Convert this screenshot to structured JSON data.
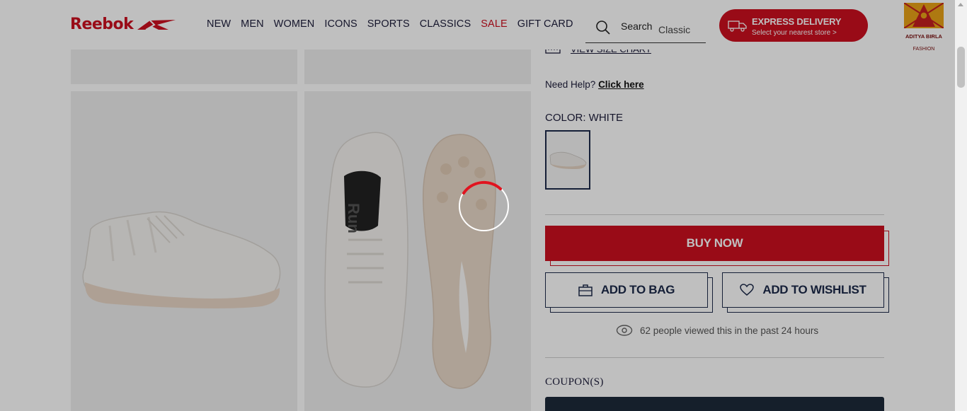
{
  "header": {
    "brand": "Reebok",
    "nav": [
      "NEW",
      "MEN",
      "WOMEN",
      "ICONS",
      "SPORTS",
      "CLASSICS",
      "SALE",
      "GIFT CARD"
    ],
    "search": {
      "label": "Search",
      "rotating_term": "Classic"
    },
    "express": {
      "title": "EXPRESS DELIVERY",
      "subtitle": "Select your nearest store >"
    },
    "partner": {
      "name": "ADITYA BIRLA",
      "sub": "FASHION"
    }
  },
  "product": {
    "size_chart_link": "VIEW SIZE CHART",
    "help_text": "Need Help?",
    "help_link": "Click here",
    "color_label": "COLOR: WHITE",
    "buy_now": "BUY NOW",
    "add_to_bag": "ADD TO BAG",
    "add_to_wishlist": "ADD TO WISHLIST",
    "viewed_text": "62 people viewed this in the past 24 hours",
    "coupons_label": "COUPON(S)"
  },
  "colors": {
    "brand_red": "#cc0f1f",
    "navy": "#1c2a4a",
    "overlay": "rgba(0,0,0,0.25)"
  },
  "icons": [
    "reebok-vector-logo",
    "search-icon",
    "truck-icon",
    "ruler-icon",
    "bag-icon",
    "heart-icon",
    "eye-icon",
    "loading-spinner"
  ]
}
